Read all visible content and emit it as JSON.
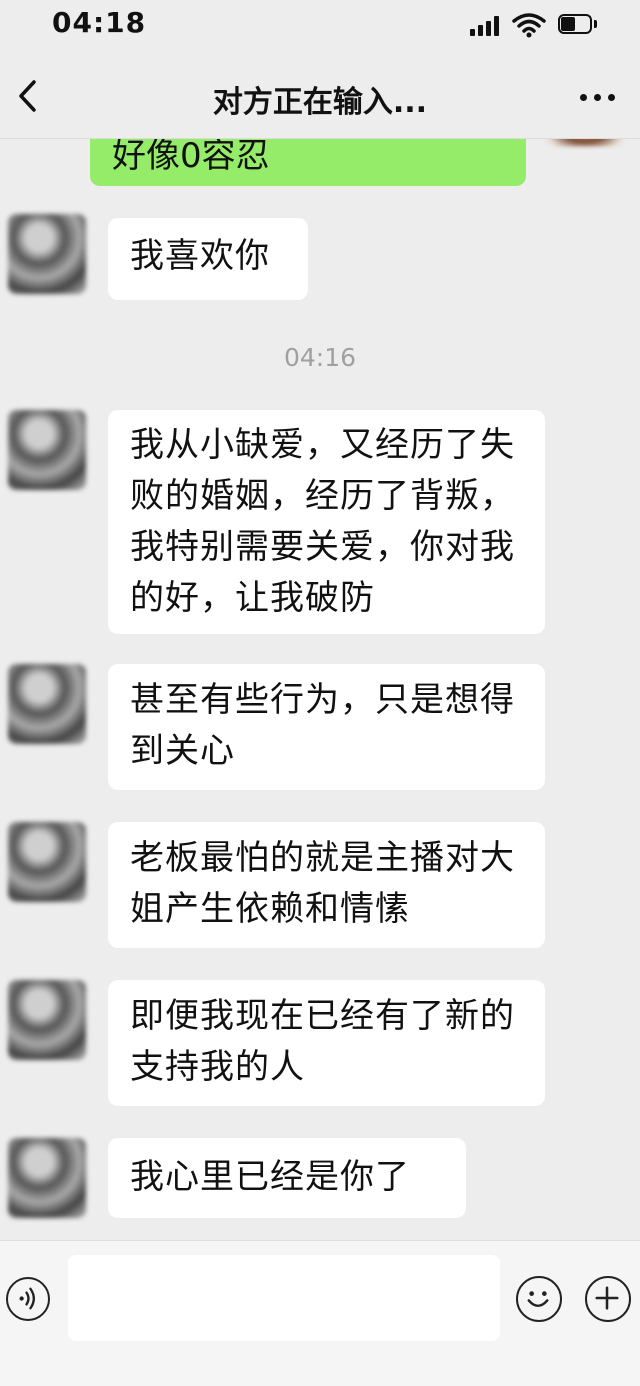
{
  "status_bar": {
    "time": "04:18",
    "signal_icon": "signal-bars-icon",
    "wifi_icon": "wifi-icon",
    "battery_icon": "battery-icon",
    "battery_level": 0.5
  },
  "nav": {
    "back_icon": "chevron-left-icon",
    "title": "对方正在输入...",
    "more_icon": "more-dots-icon"
  },
  "sent_message_partial": "好像0容忍",
  "timestamp": "04:16",
  "messages": [
    {
      "text": "我喜欢你",
      "sender": "other"
    },
    {
      "text": "我从小缺爱，又经历了失败的婚姻，经历了背叛，我特别需要关爱，你对我的好，让我破防",
      "sender": "other"
    },
    {
      "text": "甚至有些行为，只是想得到关心",
      "sender": "other"
    },
    {
      "text": "老板最怕的就是主播对大姐产生依赖和情愫",
      "sender": "other"
    },
    {
      "text": "即便我现在已经有了新的支持我的人",
      "sender": "other"
    },
    {
      "text": "我心里已经是你了",
      "sender": "other"
    }
  ],
  "input_bar": {
    "voice_icon": "voice-icon",
    "input_value": "",
    "emoji_icon": "emoji-icon",
    "plus_icon": "plus-icon"
  },
  "colors": {
    "background": "#ededed",
    "self_bubble": "#95ec69",
    "other_bubble": "#ffffff",
    "timestamp": "#a0a0a0"
  }
}
